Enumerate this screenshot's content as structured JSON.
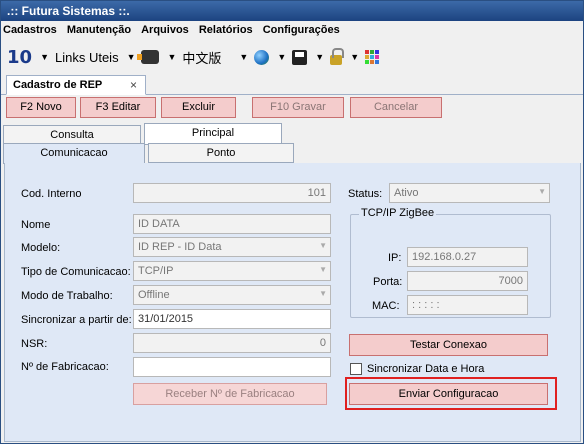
{
  "window": {
    "title": ".:: Futura Sistemas ::."
  },
  "menu": [
    "Cadastros",
    "Manutenção",
    "Arquivos",
    "Relatórios",
    "Configurações"
  ],
  "toolbar": {
    "badge": "10",
    "links_label": "Links Uteis",
    "lang_label": "中文版"
  },
  "doc_tab": {
    "title": "Cadastro de REP",
    "close": "×"
  },
  "actions": {
    "novo": "F2 Novo",
    "editar": "F3 Editar",
    "excluir": "Excluir",
    "gravar": "F10 Gravar",
    "cancelar": "Cancelar"
  },
  "tabs": {
    "consulta": "Consulta",
    "principal": "Principal",
    "comunicacao": "Comunicacao",
    "ponto": "Ponto"
  },
  "form": {
    "cod_label": "Cod. Interno",
    "cod_value": "101",
    "nome_label": "Nome",
    "nome_value": "ID DATA",
    "modelo_label": "Modelo:",
    "modelo_value": "ID REP - ID Data",
    "tipo_label": "Tipo de Comunicacao:",
    "tipo_value": "TCP/IP",
    "modo_label": "Modo de Trabalho:",
    "modo_value": "Offline",
    "sync_label": "Sincronizar a partir de:",
    "sync_value": "31/01/2015",
    "nsr_label": "NSR:",
    "nsr_value": "0",
    "fab_label": "Nº de Fabricacao:",
    "fab_value": "",
    "receber_button": "Receber Nº de Fabricacao",
    "status_label": "Status:",
    "status_value": "Ativo"
  },
  "network": {
    "group_title": "TCP/IP ZigBee",
    "ip_label": "IP:",
    "ip_value": "192.168.0.27",
    "porta_label": "Porta:",
    "porta_value": "7000",
    "mac_label": "MAC:",
    "mac_value": ": : : : :"
  },
  "buttons": {
    "testar": "Testar Conexao",
    "sync_checkbox": "Sincronizar Data e Hora",
    "enviar": "Enviar Configuracao"
  },
  "colors": {
    "title_bg": "#1c4380",
    "button_bg": "#f4cccc",
    "highlight": "#e02020",
    "panel_bg": "#dfe8f6"
  }
}
